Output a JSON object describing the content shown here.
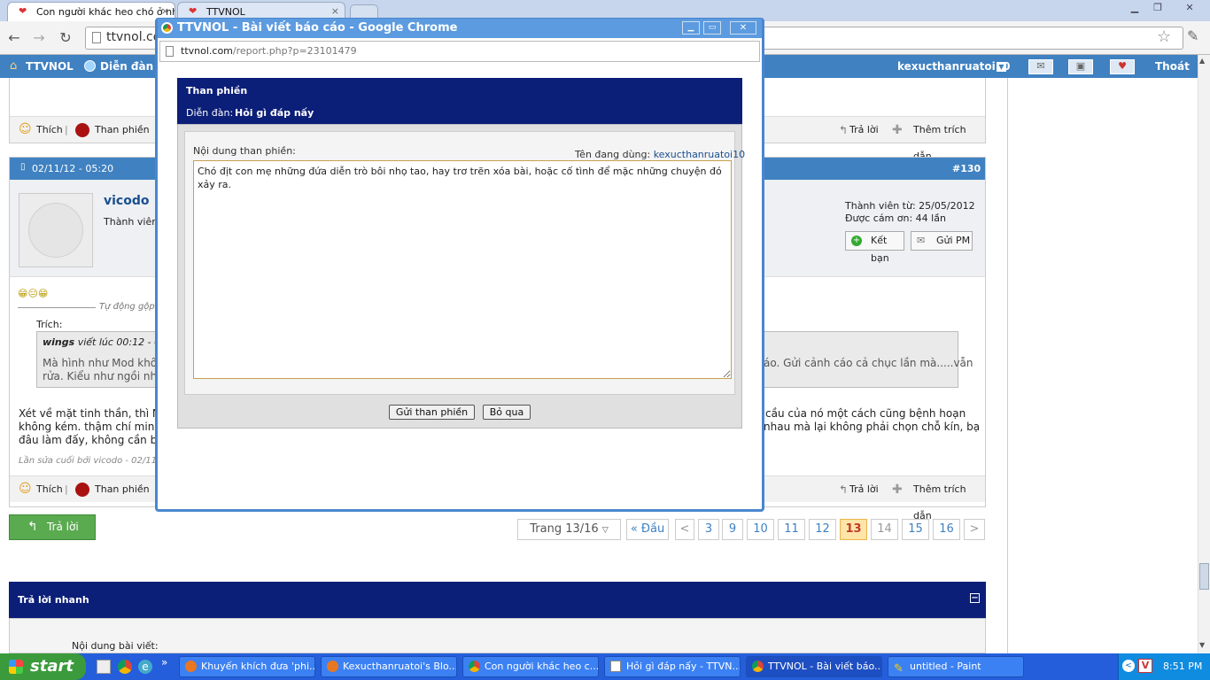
{
  "browser": {
    "tabs": [
      {
        "label": "Con người khác heo chó ở nhi",
        "close": "×"
      },
      {
        "label": "TTVNOL",
        "close": "×"
      }
    ],
    "url": "ttvnol.co",
    "window_controls": {
      "minimize": "▁",
      "restore": "❐",
      "close": "✕"
    }
  },
  "site_nav": {
    "home": "TTVNOL",
    "forum": "Diễn đàn",
    "username": "kexucthanruatoi10",
    "logout": "Thoát"
  },
  "post_top_actions": {
    "like": "Thích",
    "complain": "Than phiền",
    "reply": "Trả lời",
    "add_quote": "Thêm trích dẫn"
  },
  "post": {
    "date": "02/11/12 - 05:20",
    "number": "#130",
    "author": "vicodo",
    "author_rank": "Thành viên c",
    "member_since": "Thành viên từ: 25/05/2012",
    "thanked": "Được cám ơn: 44 lần",
    "add_friend": "Kết bạn",
    "send_pm": "Gửi PM",
    "emoticons": "😁😑😁",
    "auto_merge": "Tự động gộp",
    "quote_label": "Trích:",
    "quote_author": "wings",
    "quote_meta": "viết lúc 00:12 - 02/",
    "quote_text_1": "Mà hình như Mod không",
    "quote_text_1_end": "áo. Gửi cảnh cáo cả chục lần mà.....vẫn",
    "quote_text_2": "rửa. Kiểu như ngồi nhìn",
    "body_1": "Xét về mặt tinh thần, thì Mid r",
    "body_1_end": "cầu của nó một cách cũng bệnh hoạn",
    "body_2": "không kém. thậm chí min cò",
    "body_2_end": "nhau mà lại không phải chọn chỗ kín, bạ",
    "body_3": "đâu làm đấy, không cần biết",
    "edited": "Lần sửa cuối bởi vicodo - 02/11"
  },
  "post_bottom_actions": {
    "like": "Thích",
    "complain": "Than phiền",
    "reply": "Trả lời",
    "add_quote": "Thêm trích dẫn"
  },
  "reply_button": "Trả lời",
  "pagination": {
    "label": "Trang 13/16",
    "first": "« Đầu",
    "prev": "<",
    "next": ">",
    "pages": [
      "3",
      "9",
      "10",
      "11",
      "12",
      "13",
      "14",
      "15",
      "16"
    ],
    "current": "13"
  },
  "quick_reply": {
    "title": "Trả lời nhanh",
    "collapse": "−",
    "content_label": "Nội dung bài viết:"
  },
  "popup": {
    "title": "TTVNOL - Bài viết báo cáo - Google Chrome",
    "url_domain": "ttvnol.com",
    "url_path": "/report.php?p=23101479",
    "header_title": "Than phiền",
    "forum_label": "Diễn đàn:",
    "forum_name": "Hỏi gì đáp nấy",
    "content_label": "Nội dung than phiền:",
    "user_label": "Tên đang dùng:",
    "user_value": "kexucthanruatoi10",
    "complaint_text": "Chó địt con mẹ những đứa diễn trò bôi nhọ tao, hay trơ trẽn xóa bài, hoặc cố tình để mặc những chuyện đó xảy ra.",
    "submit": "Gửi than phiền",
    "cancel": "Bỏ qua"
  },
  "taskbar": {
    "start": "start",
    "items": [
      "Khuyến khích đưa 'phi...",
      "Kexucthanruatoi's Blo...",
      "Con người khác heo c...",
      "Hỏi gì đáp nấy - TTVN...",
      "TTVNOL - Bài viết báo...",
      "untitled - Paint"
    ],
    "quicklaunch_more": "»",
    "clock": "8:51 PM"
  },
  "colors": {
    "site_blue": "#3f81c1",
    "navy": "#0b1e78",
    "current_page": "#c0392b"
  }
}
